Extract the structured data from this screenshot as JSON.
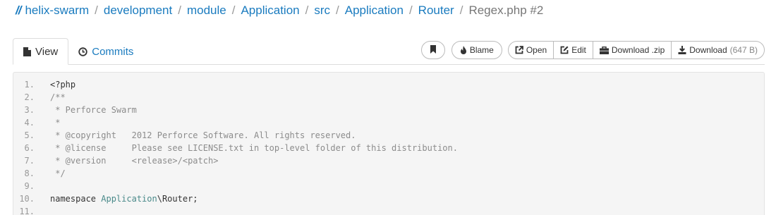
{
  "breadcrumb": {
    "slashes": "//",
    "items": [
      "helix-swarm",
      "development",
      "module",
      "Application",
      "src",
      "Application",
      "Router"
    ],
    "current": "Regex.php #2"
  },
  "tabs": [
    {
      "label": "View",
      "icon": "file-icon",
      "active": true
    },
    {
      "label": "Commits",
      "icon": "clock-icon",
      "active": false
    }
  ],
  "toolbar": {
    "blame": "Blame",
    "open": "Open",
    "edit": "Edit",
    "download_zip": "Download .zip",
    "download": "Download",
    "download_size": "(647 B)"
  },
  "code": {
    "lines": [
      {
        "n": "1.",
        "segs": [
          {
            "t": "<?php",
            "c": "php"
          }
        ]
      },
      {
        "n": "2.",
        "segs": [
          {
            "t": "/**",
            "c": "comment"
          }
        ]
      },
      {
        "n": "3.",
        "segs": [
          {
            "t": " * Perforce Swarm",
            "c": "comment"
          }
        ]
      },
      {
        "n": "4.",
        "segs": [
          {
            "t": " *",
            "c": "comment"
          }
        ]
      },
      {
        "n": "5.",
        "segs": [
          {
            "t": " * @copyright   2012 Perforce Software. All rights reserved.",
            "c": "comment"
          }
        ]
      },
      {
        "n": "6.",
        "segs": [
          {
            "t": " * @license     Please see LICENSE.txt in top-level folder of this distribution.",
            "c": "comment"
          }
        ]
      },
      {
        "n": "7.",
        "segs": [
          {
            "t": " * @version     <release>/<patch>",
            "c": "comment"
          }
        ]
      },
      {
        "n": "8.",
        "segs": [
          {
            "t": " */",
            "c": "comment"
          }
        ]
      },
      {
        "n": "9.",
        "segs": []
      },
      {
        "n": "10.",
        "segs": [
          {
            "t": "namespace ",
            "c": "kw"
          },
          {
            "t": "Application",
            "c": "ns"
          },
          {
            "t": "\\Router;",
            "c": "plain"
          }
        ]
      },
      {
        "n": "11.",
        "segs": []
      }
    ]
  },
  "colors": {
    "link": "#1a7bbf",
    "code_bg": "#f5f5f5",
    "line_number": "#999999"
  }
}
